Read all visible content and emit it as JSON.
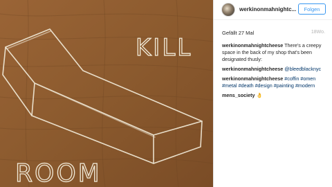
{
  "post": {
    "username": "werkinonmahnightc...",
    "follow_label": "Folgen",
    "date": "Gefällt 27 Mal",
    "age": "18Wo."
  },
  "comments": [
    {
      "user": "werkinonmahnightcheese",
      "text": "There's a creepy space in the back of my shop that's been designated thusly:"
    },
    {
      "user": "werkinonmahnightcheese",
      "mention": "@bleedblacknyc"
    },
    {
      "user": "werkinonmahnightcheese",
      "tags": [
        "#coffin",
        "#omen",
        "#metal",
        "#death",
        "#design",
        "#painting",
        "#modern"
      ]
    },
    {
      "user": "mens_society",
      "emoji": "👌"
    }
  ],
  "photo": {
    "word_top": "KILL",
    "word_bottom": "ROOM",
    "wood_color": "#8b5a2e"
  }
}
